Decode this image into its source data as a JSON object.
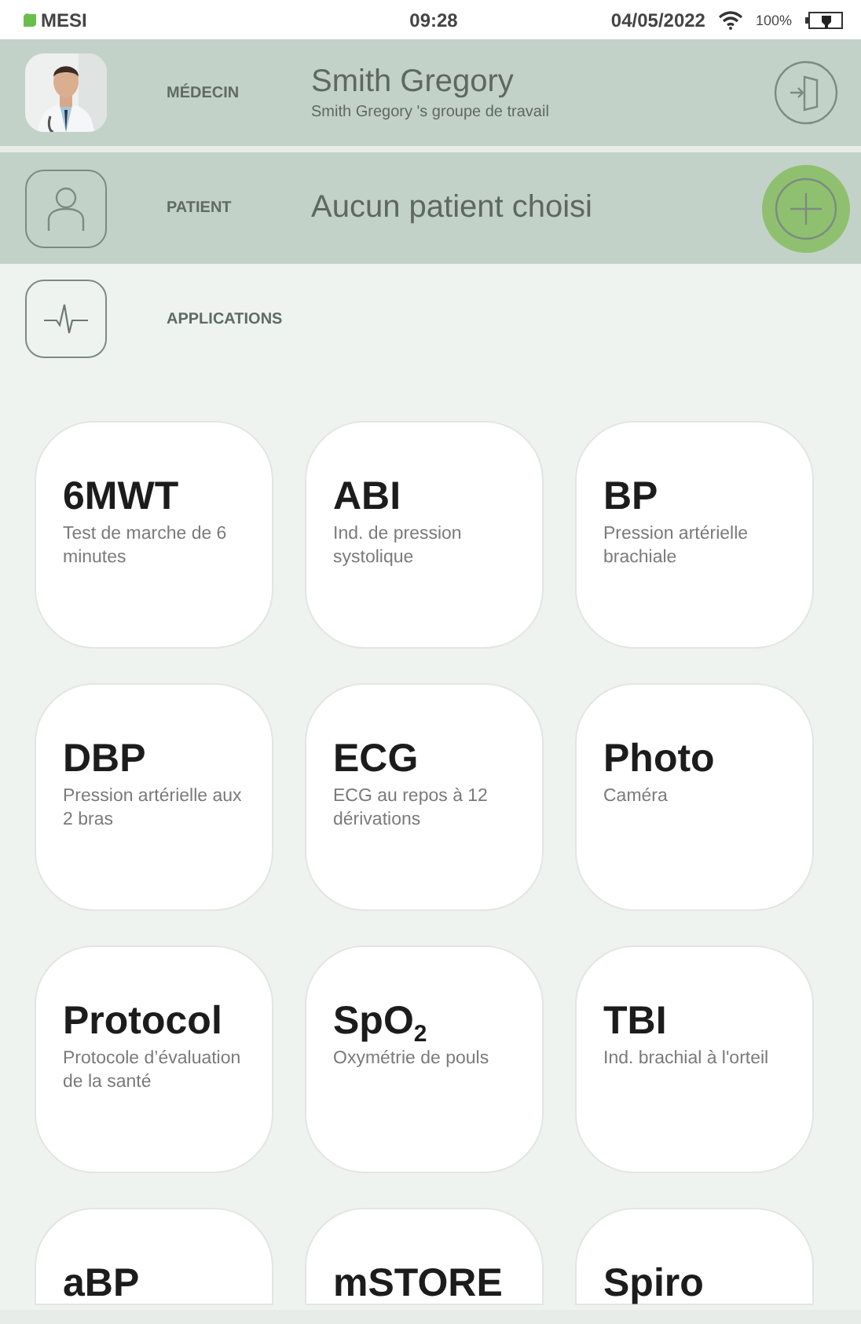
{
  "status_bar": {
    "brand": "MESI",
    "time": "09:28",
    "date": "04/05/2022",
    "battery": "100%"
  },
  "doctor": {
    "label": "MÉDECIN",
    "name": "Smith Gregory",
    "group": "Smith Gregory 's groupe de travail"
  },
  "patient": {
    "label": "PATIENT",
    "value": "Aucun patient choisi",
    "add_pressed": true
  },
  "applications": {
    "label": "APPLICATIONS"
  },
  "apps": [
    {
      "title": "6MWT",
      "description": "Test de marche de 6 minutes"
    },
    {
      "title": "ABI",
      "description": "Ind. de pression systolique"
    },
    {
      "title": "BP",
      "description": "Pression artérielle brachiale"
    },
    {
      "title": "DBP",
      "description": "Pression artérielle aux 2 bras"
    },
    {
      "title": "ECG",
      "description": "ECG au repos à 12 dérivations"
    },
    {
      "title": "Photo",
      "description": "Caméra"
    },
    {
      "title": "Protocol",
      "description": "Protocole d’évaluation de la santé"
    },
    {
      "title": "SpO$_{2}$",
      "description": "Oxymétrie de pouls"
    },
    {
      "title": "TBI",
      "description": "Ind. brachial à l'orteil"
    },
    {
      "title": "aBP"
    },
    {
      "title": "mSTORE"
    },
    {
      "title": "Spiro"
    }
  ]
}
